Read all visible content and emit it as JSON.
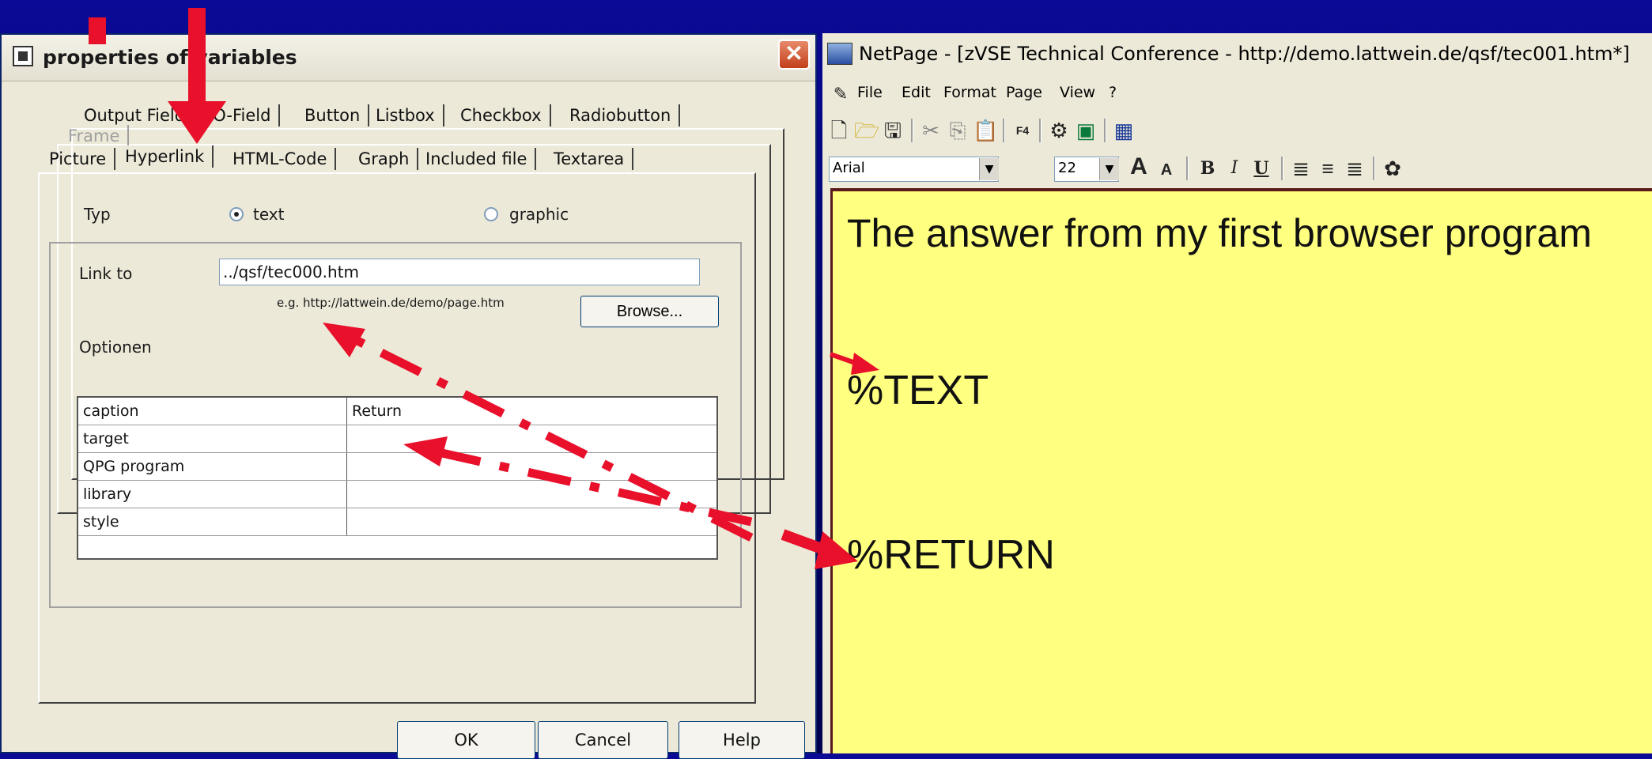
{
  "dialog": {
    "title": "properties of variables",
    "close_label": "✕",
    "tabs_row1": [
      "Output Field",
      "I/O-Field",
      "Button",
      "Listbox",
      "Checkbox",
      "Radiobutton"
    ],
    "tab_frame": "Frame",
    "tabs_row3": [
      "Picture",
      "Hyperlink",
      "HTML-Code",
      "Graph",
      "Included file",
      "Textarea"
    ],
    "active_tab": "Hyperlink",
    "typ_label": "Typ",
    "radio_text": "text",
    "radio_graphic": "graphic",
    "link_label": "Link to",
    "link_value": "../qsf/tec000.htm",
    "link_hint": "e.g. http://lattwein.de/demo/page.htm",
    "browse_label": "Browse...",
    "options_label": "Optionen",
    "options": [
      {
        "key": "caption",
        "value": "Return"
      },
      {
        "key": "target",
        "value": ""
      },
      {
        "key": "QPG program",
        "value": ""
      },
      {
        "key": "library",
        "value": ""
      },
      {
        "key": "style",
        "value": ""
      }
    ],
    "ok_label": "OK",
    "cancel_label": "Cancel",
    "help_label": "Help"
  },
  "netpage": {
    "title": "NetPage - [zVSE Technical Conference - http://demo.lattwein.de/qsf/tec001.htm*]",
    "menu": [
      "File",
      "Edit",
      "Format",
      "Page",
      "View",
      "?"
    ],
    "font": "Arial",
    "font_size": "22",
    "doc_heading": "The answer from my first browser program",
    "doc_var1": "%TEXT",
    "doc_var2": "%RETURN"
  },
  "colors": {
    "arrow": "#e8102a",
    "doc_bg": "#ffff80"
  }
}
